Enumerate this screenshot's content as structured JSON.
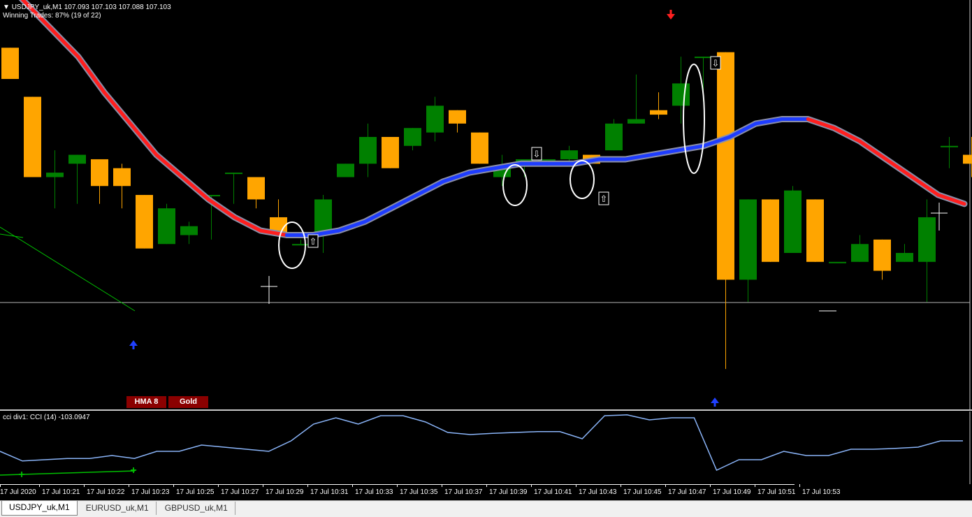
{
  "header": {
    "symbol_line": "USDJPY_uk,M1  107.093 107.103 107.088 107.103",
    "winning_trades": "Winning Trades: 87% (19 of 22)"
  },
  "buttons": {
    "hma": "HMA 8",
    "gold": "Gold"
  },
  "subwindow": {
    "label": "cci div1: CCI (14) -103.0947"
  },
  "time_labels": [
    "17 Jul 2020",
    "17 Jul 10:21",
    "17 Jul 10:22",
    "17 Jul 10:23",
    "17 Jul 10:25",
    "17 Jul 10:27",
    "17 Jul 10:29",
    "17 Jul 10:31",
    "17 Jul 10:33",
    "17 Jul 10:35",
    "17 Jul 10:37",
    "17 Jul 10:39",
    "17 Jul 10:41",
    "17 Jul 10:43",
    "17 Jul 10:45",
    "17 Jul 10:47",
    "17 Jul 10:49",
    "17 Jul 10:51",
    "17 Jul 10:53"
  ],
  "tabs": [
    {
      "label": "USDJPY_uk,M1",
      "active": true
    },
    {
      "label": "EURUSD_uk,M1",
      "active": false
    },
    {
      "label": "GBPUSD_uk,M1",
      "active": false
    }
  ],
  "colors": {
    "bull": "#008000",
    "bear": "#ffa500",
    "ma_up": "#1e3cff",
    "ma_down": "#ff1e1e",
    "cci": "#8ab4f8"
  },
  "candles": [
    {
      "o": 107.112,
      "h": 107.112,
      "l": 107.105,
      "c": 107.105
    },
    {
      "o": 107.101,
      "h": 107.101,
      "l": 107.083,
      "c": 107.083
    },
    {
      "o": 107.083,
      "h": 107.089,
      "l": 107.076,
      "c": 107.084
    },
    {
      "o": 107.086,
      "h": 107.088,
      "l": 107.077,
      "c": 107.088
    },
    {
      "o": 107.087,
      "h": 107.087,
      "l": 107.077,
      "c": 107.081
    },
    {
      "o": 107.085,
      "h": 107.086,
      "l": 107.076,
      "c": 107.081
    },
    {
      "o": 107.079,
      "h": 107.079,
      "l": 107.067,
      "c": 107.067
    },
    {
      "o": 107.068,
      "h": 107.077,
      "l": 107.068,
      "c": 107.076
    },
    {
      "o": 107.07,
      "h": 107.073,
      "l": 107.068,
      "c": 107.072
    },
    {
      "o": 107.079,
      "h": 107.079,
      "l": 107.069,
      "c": 107.079
    },
    {
      "o": 107.084,
      "h": 107.084,
      "l": 107.077,
      "c": 107.084
    },
    {
      "o": 107.083,
      "h": 107.083,
      "l": 107.076,
      "c": 107.078
    },
    {
      "o": 107.074,
      "h": 107.078,
      "l": 107.071,
      "c": 107.07
    },
    {
      "o": 107.068,
      "h": 107.069,
      "l": 107.068,
      "c": 107.068
    },
    {
      "o": 107.07,
      "h": 107.079,
      "l": 107.066,
      "c": 107.078
    },
    {
      "o": 107.083,
      "h": 107.086,
      "l": 107.083,
      "c": 107.086
    },
    {
      "o": 107.086,
      "h": 107.095,
      "l": 107.083,
      "c": 107.092
    },
    {
      "o": 107.092,
      "h": 107.092,
      "l": 107.085,
      "c": 107.085
    },
    {
      "o": 107.09,
      "h": 107.092,
      "l": 107.089,
      "c": 107.094
    },
    {
      "o": 107.093,
      "h": 107.101,
      "l": 107.091,
      "c": 107.099
    },
    {
      "o": 107.098,
      "h": 107.098,
      "l": 107.093,
      "c": 107.095
    },
    {
      "o": 107.093,
      "h": 107.093,
      "l": 107.086,
      "c": 107.086
    },
    {
      "o": 107.083,
      "h": 107.088,
      "l": 107.081,
      "c": 107.085
    },
    {
      "o": 107.086,
      "h": 107.087,
      "l": 107.083,
      "c": 107.087
    },
    {
      "o": 107.087,
      "h": 107.087,
      "l": 107.087,
      "c": 107.087
    },
    {
      "o": 107.087,
      "h": 107.09,
      "l": 107.086,
      "c": 107.089
    },
    {
      "o": 107.088,
      "h": 107.088,
      "l": 107.088,
      "c": 107.086
    },
    {
      "o": 107.089,
      "h": 107.096,
      "l": 107.089,
      "c": 107.095
    },
    {
      "o": 107.095,
      "h": 107.106,
      "l": 107.095,
      "c": 107.096
    },
    {
      "o": 107.098,
      "h": 107.102,
      "l": 107.096,
      "c": 107.097
    },
    {
      "o": 107.099,
      "h": 107.11,
      "l": 107.095,
      "c": 107.104
    },
    {
      "o": 107.11,
      "h": 107.11,
      "l": 107.1,
      "c": 107.11
    },
    {
      "o": 107.111,
      "h": 107.111,
      "l": 107.04,
      "c": 107.06
    },
    {
      "o": 107.06,
      "h": 107.068,
      "l": 107.055,
      "c": 107.078
    },
    {
      "o": 107.078,
      "h": 107.078,
      "l": 107.064,
      "c": 107.064
    },
    {
      "o": 107.066,
      "h": 107.081,
      "l": 107.066,
      "c": 107.08
    },
    {
      "o": 107.078,
      "h": 107.078,
      "l": 107.064,
      "c": 107.064
    },
    {
      "o": 107.064,
      "h": 107.064,
      "l": 107.064,
      "c": 107.064
    },
    {
      "o": 107.064,
      "h": 107.07,
      "l": 107.064,
      "c": 107.068
    },
    {
      "o": 107.069,
      "h": 107.069,
      "l": 107.06,
      "c": 107.062
    },
    {
      "o": 107.064,
      "h": 107.068,
      "l": 107.064,
      "c": 107.066
    },
    {
      "o": 107.064,
      "h": 107.078,
      "l": 107.055,
      "c": 107.074
    },
    {
      "o": 107.09,
      "h": 107.092,
      "l": 107.085,
      "c": 107.09
    },
    {
      "o": 107.088,
      "h": 107.092,
      "l": 107.083,
      "c": 107.086
    }
  ],
  "cci_values": [
    55,
    32,
    35,
    38,
    38,
    45,
    38,
    55,
    55,
    70,
    65,
    60,
    55,
    80,
    120,
    135,
    120,
    140,
    140,
    125,
    100,
    95,
    98,
    100,
    102,
    102,
    85,
    140,
    142,
    130,
    135,
    135,
    10,
    35,
    35,
    55,
    45,
    45,
    60,
    60,
    62,
    65,
    80,
    80
  ],
  "hma_values": [
    107.128,
    107.122,
    107.116,
    107.11,
    107.102,
    107.095,
    107.088,
    107.083,
    107.078,
    107.074,
    107.071,
    107.07,
    107.07,
    107.071,
    107.073,
    107.076,
    107.079,
    107.082,
    107.084,
    107.085,
    107.086,
    107.086,
    107.086,
    107.087,
    107.087,
    107.088,
    107.089,
    107.09,
    107.092,
    107.095,
    107.096,
    107.096,
    107.094,
    107.091,
    107.087,
    107.083,
    107.079,
    107.077
  ]
}
